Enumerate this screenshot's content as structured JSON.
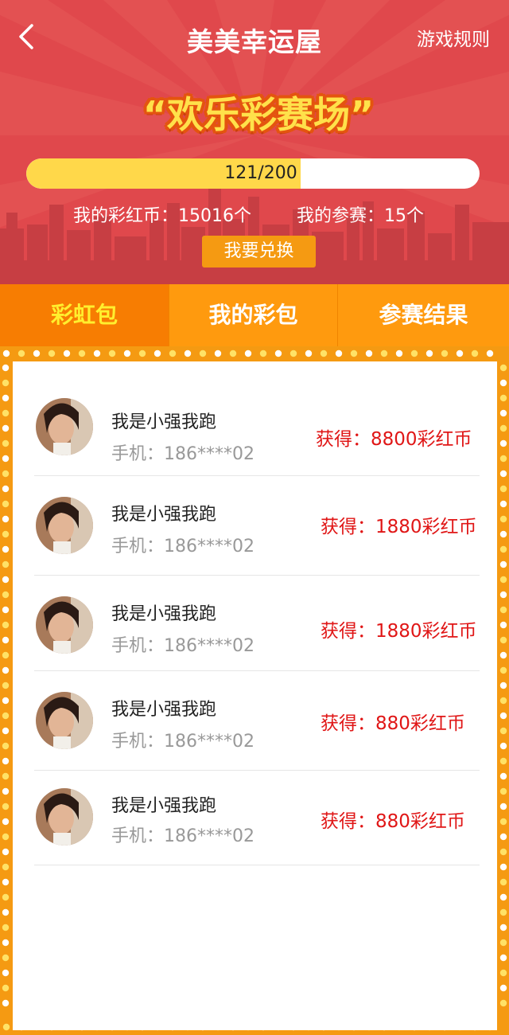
{
  "header": {
    "title": "美美幸运屋",
    "rules_label": "游戏规则",
    "banner": "“欢乐彩赛场”"
  },
  "progress": {
    "text": "121/200",
    "current": 121,
    "max": 200
  },
  "stats": {
    "coins": "我的彩红币：15016个",
    "entries": "我的参赛：15个"
  },
  "redeem_label": "我要兑换",
  "tabs": [
    {
      "label": "彩虹包"
    },
    {
      "label": "我的彩包"
    },
    {
      "label": "参赛结果"
    }
  ],
  "list": [
    {
      "name": "我是小强我跑",
      "phone": "手机：186****02",
      "reward": "获得：8800彩红币"
    },
    {
      "name": "我是小强我跑",
      "phone": "手机：186****02",
      "reward": "获得：1880彩红币"
    },
    {
      "name": "我是小强我跑",
      "phone": "手机：186****02",
      "reward": "获得：1880彩红币"
    },
    {
      "name": "我是小强我跑",
      "phone": "手机：186****02",
      "reward": "获得：880彩红币"
    },
    {
      "name": "我是小强我跑",
      "phone": "手机：186****02",
      "reward": "获得：880彩红币"
    }
  ],
  "colors": {
    "header_red": "#e0484c",
    "tab_orange": "#ff9a0e",
    "tab_active": "#f77d02",
    "active_text": "#ffef2e",
    "reward_red": "#e01616",
    "progress_fill": "#ffd84a"
  }
}
